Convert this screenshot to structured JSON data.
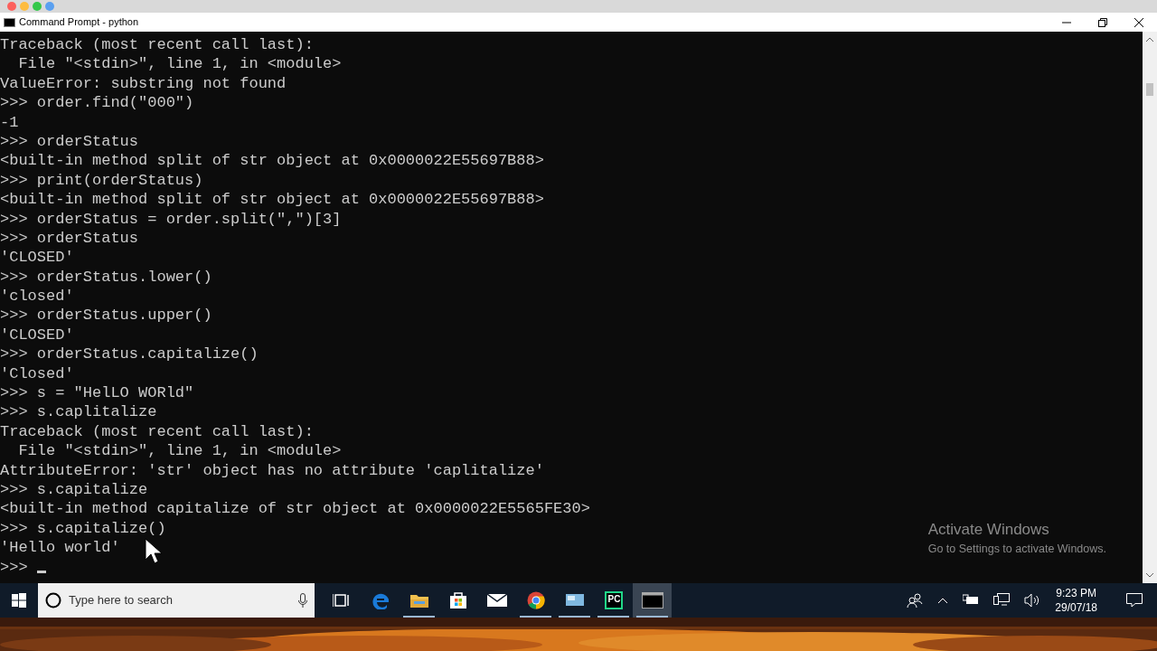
{
  "window": {
    "title": "Command Prompt - python"
  },
  "console": {
    "lines": [
      "Traceback (most recent call last):",
      "  File \"<stdin>\", line 1, in <module>",
      "ValueError: substring not found",
      ">>> order.find(\"000\")",
      "-1",
      ">>> orderStatus",
      "<built-in method split of str object at 0x0000022E55697B88>",
      ">>> print(orderStatus)",
      "<built-in method split of str object at 0x0000022E55697B88>",
      ">>> orderStatus = order.split(\",\")[3]",
      ">>> orderStatus",
      "'CLOSED'",
      ">>> orderStatus.lower()",
      "'closed'",
      ">>> orderStatus.upper()",
      "'CLOSED'",
      ">>> orderStatus.capitalize()",
      "'Closed'",
      ">>> s = \"HelLO WORld\"",
      ">>> s.caplitalize",
      "Traceback (most recent call last):",
      "  File \"<stdin>\", line 1, in <module>",
      "AttributeError: 'str' object has no attribute 'caplitalize'",
      ">>> s.capitalize",
      "<built-in method capitalize of str object at 0x0000022E5565FE30>",
      ">>> s.capitalize()",
      "'Hello world'"
    ],
    "prompt": ">>>"
  },
  "activation": {
    "title": "Activate Windows",
    "message": "Go to Settings to activate Windows."
  },
  "taskbar": {
    "search": {
      "placeholder": "Type here to search"
    },
    "apps": [
      {
        "kind": "taskview",
        "running": false,
        "active": false
      },
      {
        "kind": "edge",
        "running": false,
        "active": false
      },
      {
        "kind": "explorer",
        "running": true,
        "active": false
      },
      {
        "kind": "store",
        "running": false,
        "active": false
      },
      {
        "kind": "mail",
        "running": false,
        "active": false
      },
      {
        "kind": "chrome",
        "running": true,
        "active": false
      },
      {
        "kind": "remote",
        "running": true,
        "active": false
      },
      {
        "kind": "pycharm",
        "running": true,
        "active": false,
        "label": "PC"
      },
      {
        "kind": "terminal",
        "running": true,
        "active": true
      }
    ],
    "time": "9:23 PM",
    "date": "29/07/18"
  }
}
